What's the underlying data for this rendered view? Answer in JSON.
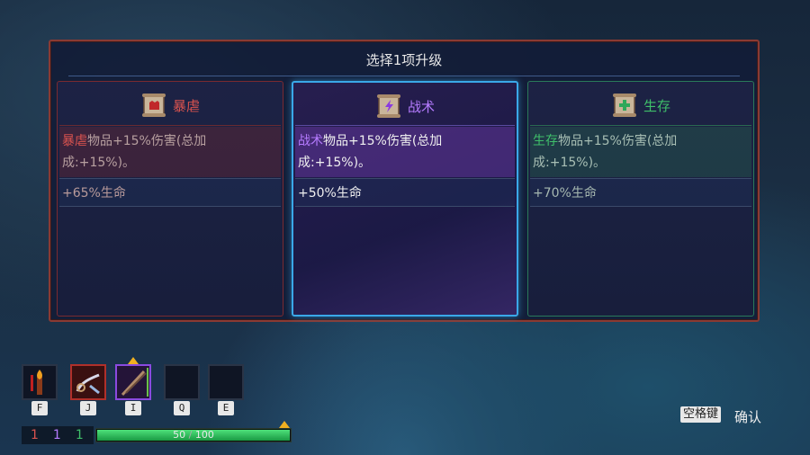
{
  "dialog": {
    "title": "选择1项升级",
    "options": [
      {
        "name": "暴虐",
        "color": "#d9534f",
        "keyword": "暴虐",
        "desc_rest": "物品+15%伤害(总加成:+15%)。",
        "bonus": "+65%生命",
        "icon": "brutality-scroll-icon"
      },
      {
        "name": "战术",
        "color": "#b57bff",
        "keyword": "战术",
        "desc_rest": "物品+15%伤害(总加成:+15%)。",
        "bonus": "+50%生命",
        "icon": "tactics-scroll-icon",
        "selected": true
      },
      {
        "name": "生存",
        "color": "#3fbf6a",
        "keyword": "生存",
        "desc_rest": "物品+15%伤害(总加成:+15%)。",
        "bonus": "+70%生命",
        "icon": "survival-scroll-icon"
      }
    ]
  },
  "hud": {
    "slots": [
      {
        "key": "F",
        "icon": "torch-icon"
      },
      {
        "key": "J",
        "icon": "whip-weapon-icon"
      },
      {
        "key": "I",
        "icon": "bow-weapon-icon"
      },
      {
        "key": "Q",
        "icon": "empty-slot"
      },
      {
        "key": "E",
        "icon": "empty-slot"
      }
    ],
    "counts": {
      "brutality": "1",
      "tactics": "1",
      "survival": "1"
    },
    "hp": {
      "current": "50",
      "separator": "/",
      "max": "100",
      "fraction": 1.0
    }
  },
  "prompt": {
    "key": "空格键",
    "label": "确认"
  }
}
